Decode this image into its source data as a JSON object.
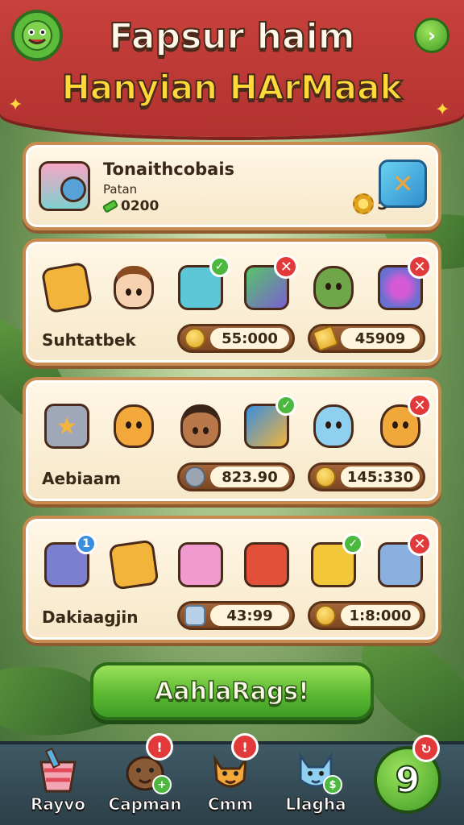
{
  "header": {
    "title_line1": "Fapsur haim",
    "title_line2": "Hanyian HArMaak",
    "logo_icon": "monster-logo-icon",
    "next_icon": "chevron-right-icon"
  },
  "profile": {
    "name": "Tonaithcobais",
    "subtitle": "Patan",
    "currency_value": "0200",
    "level_value": "5",
    "camera_icon": "camera-icon",
    "tool_icon": "crossed-tools-icon"
  },
  "rows": [
    {
      "label": "Suhtatbek",
      "price_a": "55:000",
      "price_b": "45909",
      "items": [
        "ticket-item",
        "girl-character",
        "backpack-item",
        "tablet-item",
        "cat-character",
        "speaker-item"
      ],
      "badges": [
        "",
        "",
        "ok",
        "x",
        "",
        "x"
      ]
    },
    {
      "label": "Aebiaam",
      "price_a": "823.90",
      "price_b": "145:330",
      "items": [
        "star-frame-item",
        "fox-character",
        "boy-character",
        "kite-item",
        "cat-blue-character",
        "fox-orange-character"
      ],
      "badges": [
        "",
        "",
        "",
        "ok",
        "",
        "x"
      ]
    },
    {
      "label": "Dakiaagjin",
      "price_a": "43:99",
      "price_b": "1:8:000",
      "items": [
        "tablet-cat-item",
        "toy-box-item",
        "puzzle-item",
        "chest-item",
        "cart-item",
        "monitor-item"
      ],
      "badges": [
        "num",
        "",
        "",
        "",
        "ok",
        "x"
      ]
    }
  ],
  "badge_number": "1",
  "cta_label": "AahlaRags!",
  "bottom_nav": [
    {
      "label": "Rayvo",
      "icon": "paint-bucket-icon"
    },
    {
      "label": "Capman",
      "icon": "bear-character-icon"
    },
    {
      "label": "Cmm",
      "icon": "fox-character-icon"
    },
    {
      "label": "Llagha",
      "icon": "cat-character-icon"
    }
  ],
  "round_button_label": "9"
}
